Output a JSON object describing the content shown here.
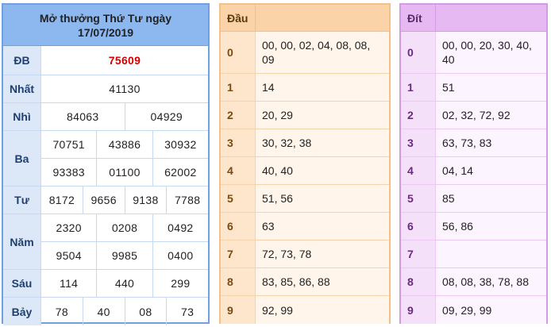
{
  "results": {
    "title_line1": "Mở thưởng Thứ Tư ngày",
    "title_line2": "17/07/2019",
    "rows": [
      {
        "label": "ĐB",
        "lines": [
          [
            "75609"
          ]
        ]
      },
      {
        "label": "Nhất",
        "lines": [
          [
            "41130"
          ]
        ]
      },
      {
        "label": "Nhì",
        "lines": [
          [
            "84063",
            "04929"
          ]
        ]
      },
      {
        "label": "Ba",
        "lines": [
          [
            "70751",
            "43886",
            "30932"
          ],
          [
            "93383",
            "01100",
            "62002"
          ]
        ]
      },
      {
        "label": "Tư",
        "lines": [
          [
            "8172",
            "9656",
            "9138",
            "7788"
          ]
        ]
      },
      {
        "label": "Năm",
        "lines": [
          [
            "2320",
            "0208",
            "0492"
          ],
          [
            "9504",
            "9985",
            "0400"
          ]
        ]
      },
      {
        "label": "Sáu",
        "lines": [
          [
            "114",
            "440",
            "299"
          ]
        ]
      },
      {
        "label": "Bảy",
        "lines": [
          [
            "78",
            "40",
            "08",
            "73"
          ]
        ]
      }
    ]
  },
  "dau": {
    "header": "Đầu",
    "rows": [
      {
        "key": "0",
        "value": "00, 00, 02, 04, 08, 08, 09"
      },
      {
        "key": "1",
        "value": "14"
      },
      {
        "key": "2",
        "value": "20, 29"
      },
      {
        "key": "3",
        "value": "30, 32, 38"
      },
      {
        "key": "4",
        "value": "40, 40"
      },
      {
        "key": "5",
        "value": "51, 56"
      },
      {
        "key": "6",
        "value": "63"
      },
      {
        "key": "7",
        "value": "72, 73, 78"
      },
      {
        "key": "8",
        "value": "83, 85, 86, 88"
      },
      {
        "key": "9",
        "value": "92, 99"
      }
    ]
  },
  "dit": {
    "header": "Đít",
    "rows": [
      {
        "key": "0",
        "value": "00, 00, 20, 30, 40, 40"
      },
      {
        "key": "1",
        "value": "51"
      },
      {
        "key": "2",
        "value": "02, 32, 72, 92"
      },
      {
        "key": "3",
        "value": "63, 73, 83"
      },
      {
        "key": "4",
        "value": "04, 14"
      },
      {
        "key": "5",
        "value": "85"
      },
      {
        "key": "6",
        "value": "56, 86"
      },
      {
        "key": "7",
        "value": ""
      },
      {
        "key": "8",
        "value": "08, 08, 38, 78, 88"
      },
      {
        "key": "9",
        "value": "09, 29, 99"
      }
    ]
  },
  "colors": {
    "special_prize": "#d40000",
    "results_border": "#6fa0e0",
    "dau_border": "#f3c08a",
    "dit_border": "#d59ae6"
  }
}
